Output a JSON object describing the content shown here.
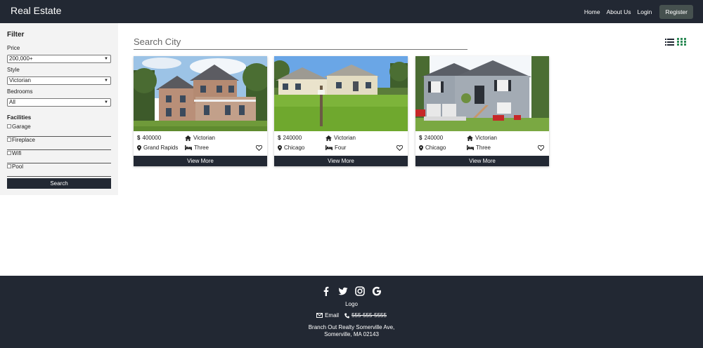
{
  "nav": {
    "brand": "Real Estate",
    "links": [
      "Home",
      "About Us",
      "Login"
    ],
    "register": "Register"
  },
  "sidebar": {
    "title": "Filter",
    "price_label": "Price",
    "price_value": "200,000+",
    "style_label": "Style",
    "style_value": "Victorian",
    "bedrooms_label": "Bedrooms",
    "bedrooms_value": "All",
    "facilities_title": "Facilities",
    "facilities": [
      "Garage",
      "Fireplace",
      "Wifi",
      "Pool"
    ],
    "search_button": "Search"
  },
  "main": {
    "search_placeholder": "Search City",
    "view_options": [
      "list-icon",
      "grid-icon"
    ],
    "active_view": "grid"
  },
  "cards": [
    {
      "price": "400000",
      "style": "Victorian",
      "city": "Grand Rapids",
      "bedrooms": "Three",
      "button": "View More"
    },
    {
      "price": "240000",
      "style": "Victorian",
      "city": "Chicago",
      "bedrooms": "Four",
      "button": "View More"
    },
    {
      "price": "240000",
      "style": "Victorian",
      "city": "Chicago",
      "bedrooms": "Three",
      "button": "View More"
    }
  ],
  "footer": {
    "social": [
      "facebook-icon",
      "twitter-icon",
      "instagram-icon",
      "google-icon"
    ],
    "logo": "Logo",
    "email": "Email",
    "phone": "555-555-5555",
    "address_line1": "Branch Out Realty Somerville Ave,",
    "address_line2": "Somerville, MA 02143"
  },
  "colors": {
    "dark": "#222833",
    "accent_green": "#2e8b57",
    "register_bg": "#46514f",
    "sidebar_bg": "#f3f3f3"
  }
}
